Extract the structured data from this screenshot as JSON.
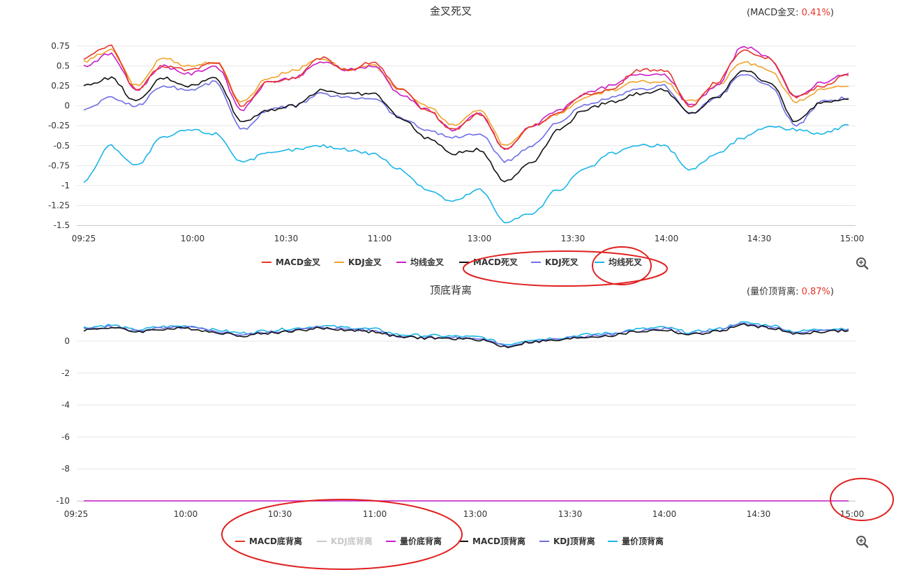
{
  "colors": {
    "red": "#e6352b",
    "orange": "#f0a32a",
    "magenta": "#c81ec8",
    "black": "#111111",
    "purple": "#6e6ee6",
    "cyan": "#1ab5e8",
    "annotation": "#e02020",
    "disabled": "#c8c8c8"
  },
  "toolbar": {
    "zoom_icon": "zoom-in-icon"
  },
  "chart_data": [
    {
      "type": "line",
      "title": "金叉死叉",
      "corner_label": "(MACD金叉: ",
      "corner_value": "0.41%",
      "corner_close": ")",
      "x_ticks": [
        "09:25",
        "10:00",
        "10:30",
        "11:00",
        "13:00",
        "13:30",
        "14:00",
        "14:30",
        "15:00"
      ],
      "y_ticks": [
        "0.75",
        "0.5",
        "0.25",
        "0",
        "-0.25",
        "-0.5",
        "-0.75",
        "-1",
        "-1.25",
        "-1.5"
      ],
      "ylim": [
        -1.5,
        0.75
      ],
      "legend_placement": "bottom",
      "grid": true,
      "x": [
        0,
        4,
        8,
        12,
        16,
        20,
        24,
        28,
        32,
        36,
        40,
        44,
        48,
        52,
        56,
        60,
        64,
        68,
        72,
        76,
        80,
        84,
        88,
        92,
        96,
        100
      ],
      "series": [
        {
          "name": "MACD金叉",
          "color": "red",
          "values": [
            0.6,
            0.75,
            0.2,
            0.5,
            0.45,
            0.55,
            0.0,
            0.3,
            0.35,
            0.6,
            0.45,
            0.55,
            0.2,
            -0.05,
            -0.3,
            -0.1,
            -0.55,
            -0.25,
            -0.1,
            0.15,
            0.2,
            0.45,
            0.45,
            0.0,
            0.3,
            0.7,
            0.6,
            0.1,
            0.25,
            0.4
          ]
        },
        {
          "name": "KDJ金叉",
          "color": "orange",
          "values": [
            0.55,
            0.7,
            0.25,
            0.6,
            0.5,
            0.55,
            0.05,
            0.35,
            0.45,
            0.6,
            0.45,
            0.5,
            0.2,
            0.0,
            -0.25,
            -0.05,
            -0.5,
            -0.25,
            -0.1,
            0.1,
            0.2,
            0.3,
            0.3,
            0.05,
            0.25,
            0.55,
            0.45,
            0.05,
            0.2,
            0.25
          ]
        },
        {
          "name": "均线金叉",
          "color": "magenta",
          "values": [
            0.5,
            0.65,
            0.2,
            0.5,
            0.4,
            0.5,
            -0.05,
            0.3,
            0.35,
            0.55,
            0.45,
            0.5,
            0.15,
            -0.05,
            -0.3,
            -0.1,
            -0.55,
            -0.25,
            -0.05,
            0.15,
            0.25,
            0.4,
            0.4,
            0.0,
            0.25,
            0.75,
            0.6,
            0.1,
            0.3,
            0.4
          ]
        },
        {
          "name": "MACD死叉",
          "color": "black",
          "values": [
            0.25,
            0.35,
            0.05,
            0.35,
            0.25,
            0.35,
            -0.2,
            -0.05,
            0.0,
            0.2,
            0.15,
            0.15,
            -0.15,
            -0.4,
            -0.6,
            -0.55,
            -0.95,
            -0.7,
            -0.3,
            -0.05,
            0.05,
            0.15,
            0.2,
            -0.1,
            0.1,
            0.45,
            0.3,
            -0.2,
            0.05,
            0.1
          ]
        },
        {
          "name": "KDJ死叉",
          "color": "purple",
          "values": [
            -0.05,
            0.1,
            0.0,
            0.25,
            0.2,
            0.3,
            -0.3,
            -0.05,
            0.0,
            0.15,
            0.1,
            0.1,
            -0.15,
            -0.3,
            -0.4,
            -0.35,
            -0.7,
            -0.5,
            -0.2,
            0.0,
            0.1,
            0.2,
            0.25,
            -0.1,
            0.1,
            0.4,
            0.25,
            -0.25,
            0.05,
            0.1
          ]
        },
        {
          "name": "均线死叉",
          "color": "cyan",
          "values": [
            -0.95,
            -0.5,
            -0.75,
            -0.4,
            -0.3,
            -0.35,
            -0.7,
            -0.6,
            -0.55,
            -0.5,
            -0.55,
            -0.6,
            -0.8,
            -1.05,
            -1.2,
            -1.05,
            -1.45,
            -1.35,
            -1.05,
            -0.8,
            -0.6,
            -0.5,
            -0.5,
            -0.8,
            -0.6,
            -0.4,
            -0.25,
            -0.3,
            -0.35,
            -0.25
          ]
        }
      ]
    },
    {
      "type": "line",
      "title": "顶底背离",
      "corner_label": "(量价顶背离: ",
      "corner_value": "0.87%",
      "corner_close": ")",
      "x_ticks": [
        "09:25",
        "10:00",
        "10:30",
        "11:00",
        "13:00",
        "13:30",
        "14:00",
        "14:30",
        "15:00"
      ],
      "y_ticks": [
        "0",
        "-2",
        "-4",
        "-6",
        "-8",
        "-10"
      ],
      "ylim": [
        -10,
        0
      ],
      "legend_placement": "bottom",
      "grid": true,
      "series": [
        {
          "name": "MACD底背离",
          "color": "red",
          "visible": false,
          "values": []
        },
        {
          "name": "KDJ底背离",
          "color": "disabled",
          "visible": false,
          "disabled": true,
          "values": []
        },
        {
          "name": "量价底背离",
          "color": "magenta",
          "values": [
            -10,
            -10,
            -10,
            -10,
            -10,
            -10,
            -10,
            -10,
            -10,
            -10,
            -10,
            -10,
            -10,
            -10,
            -10,
            -10,
            -10,
            -10,
            -10,
            -10,
            -10,
            -10,
            -10,
            -10,
            -10,
            -10,
            -10,
            -10,
            -10,
            -10
          ]
        },
        {
          "name": "MACD顶背离",
          "color": "black",
          "values": [
            0.7,
            0.85,
            0.6,
            0.75,
            0.8,
            0.55,
            0.35,
            0.5,
            0.65,
            0.8,
            0.7,
            0.6,
            0.25,
            0.2,
            0.15,
            0.1,
            -0.35,
            -0.05,
            0.05,
            0.25,
            0.35,
            0.6,
            0.7,
            0.4,
            0.6,
            1.0,
            0.85,
            0.45,
            0.6,
            0.65
          ]
        },
        {
          "name": "KDJ顶背离",
          "color": "purple",
          "values": [
            0.75,
            0.9,
            0.65,
            0.8,
            0.85,
            0.6,
            0.4,
            0.55,
            0.7,
            0.85,
            0.75,
            0.65,
            0.3,
            0.25,
            0.2,
            0.15,
            -0.3,
            0.0,
            0.1,
            0.3,
            0.4,
            0.65,
            0.75,
            0.45,
            0.65,
            1.05,
            0.9,
            0.5,
            0.65,
            0.7
          ]
        },
        {
          "name": "量价顶背离",
          "color": "cyan",
          "values": [
            0.85,
            1.0,
            0.7,
            0.9,
            0.95,
            0.7,
            0.5,
            0.65,
            0.8,
            0.95,
            0.85,
            0.75,
            0.4,
            0.35,
            0.3,
            0.25,
            -0.2,
            0.1,
            0.2,
            0.4,
            0.5,
            0.75,
            0.85,
            0.55,
            0.75,
            1.15,
            1.0,
            0.6,
            0.75,
            0.8
          ]
        }
      ]
    }
  ]
}
